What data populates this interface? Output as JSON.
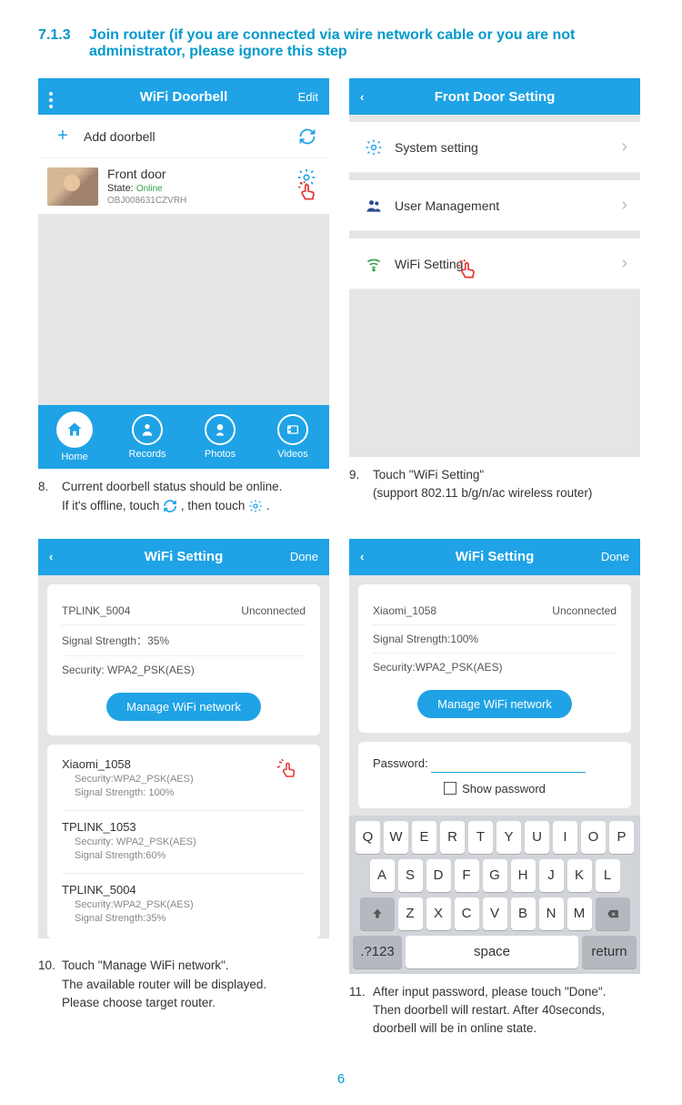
{
  "heading": {
    "num": "7.1.3",
    "text": "Join router (if you are connected via wire network cable or you are not administrator, please ignore this step"
  },
  "screen1": {
    "title": "WiFi Doorbell",
    "edit": "Edit",
    "addDoorbell": "Add doorbell",
    "device": {
      "name": "Front door",
      "stateLabel": "State:",
      "state": "Online",
      "id": "OBJ008631CZVRH"
    },
    "tabs": {
      "home": "Home",
      "records": "Records",
      "photos": "Photos",
      "videos": "Videos"
    }
  },
  "caption8": {
    "n": "8.",
    "l1": "Current doorbell status should be online.",
    "l2a": "If it's offline, touch ",
    "l2b": " , then touch ",
    "l2c": " ."
  },
  "screen2": {
    "title": "Front Door Setting",
    "items": {
      "system": "System setting",
      "user": "User Management",
      "wifi": "WiFi Setting"
    }
  },
  "caption9": {
    "n": "9.",
    "l1": "Touch \"WiFi Setting\"",
    "l2": "(support 802.11 b/g/n/ac wireless router)"
  },
  "screen3": {
    "title": "WiFi Setting",
    "done": "Done",
    "current": {
      "ssid": "TPLINK_5004",
      "status": "Unconnected",
      "signalLabel": "Signal Strength：",
      "signal": "35%",
      "securityLabel": "Security:",
      "security": "WPA2_PSK(AES)"
    },
    "manageBtn": "Manage WiFi network",
    "list": [
      {
        "ssid": "Xiaomi_1058",
        "security": "Security:WPA2_PSK(AES)",
        "signal": "Signal Strength: 100%"
      },
      {
        "ssid": "TPLINK_1053",
        "security": "Security:  WPA2_PSK(AES)",
        "signal": "Signal Strength:60%"
      },
      {
        "ssid": "TPLINK_5004",
        "security": "Security:WPA2_PSK(AES)",
        "signal": "Signal Strength:35%"
      }
    ]
  },
  "caption10": {
    "n": "10.",
    "l1": "Touch \"Manage WiFi network\".",
    "l2": "The available router will be displayed.",
    "l3": "Please choose target router."
  },
  "screen4": {
    "title": "WiFi Setting",
    "done": "Done",
    "current": {
      "ssid": "Xiaomi_1058",
      "status": "Unconnected",
      "signalLabel": "Signal Strength:",
      "signal": "100%",
      "securityLabel": "Security:",
      "security": "WPA2_PSK(AES)"
    },
    "manageBtn": "Manage WiFi network",
    "passwordLabel": "Password:",
    "showPassword": "Show password",
    "keys": {
      "r1": [
        "Q",
        "W",
        "E",
        "R",
        "T",
        "Y",
        "U",
        "I",
        "O",
        "P"
      ],
      "r2": [
        "A",
        "S",
        "D",
        "F",
        "G",
        "H",
        "J",
        "K",
        "L"
      ],
      "r3": [
        "Z",
        "X",
        "C",
        "V",
        "B",
        "N",
        "M"
      ],
      "sym": ".?123",
      "space": "space",
      "return": "return"
    }
  },
  "caption11": {
    "n": "11.",
    "l1": "After input password, please touch \"Done\".",
    "l2": "Then doorbell will restart. After 40seconds,",
    "l3": "doorbell will be in online state."
  },
  "pageNumber": "6"
}
